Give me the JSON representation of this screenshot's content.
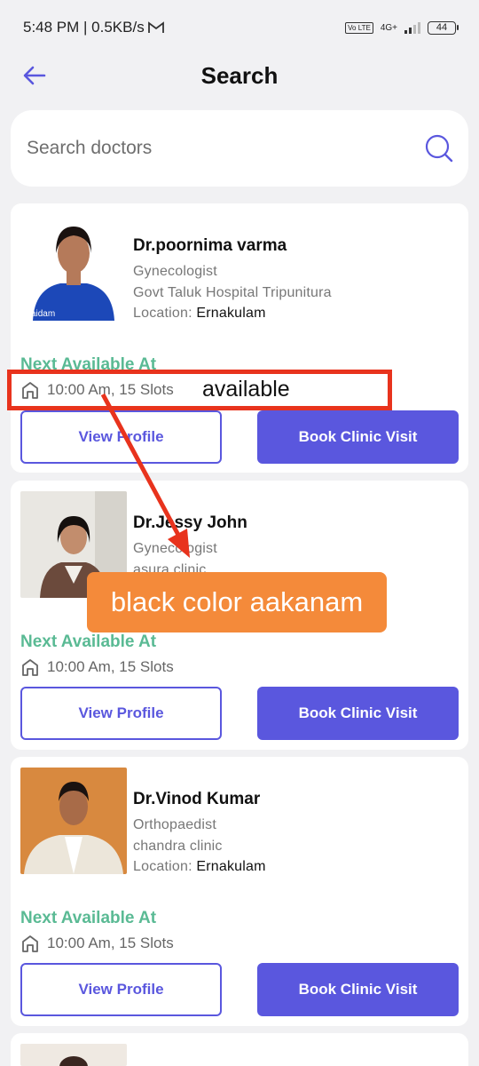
{
  "status_bar": {
    "time_speed": "5:48 PM | 0.5KB/s",
    "mail_icon": "gmail-icon",
    "network": "4G+",
    "volte": "Vo LTE",
    "battery": "44"
  },
  "header": {
    "title": "Search"
  },
  "search": {
    "placeholder": "Search doctors"
  },
  "cards": [
    {
      "name": "Dr.poornima varma",
      "specialty": "Gynecologist",
      "clinic": "Govt Taluk Hospital Tripunitura",
      "location_label": "Location: ",
      "location_value": "Ernakulam",
      "next_label": "Next Available At",
      "slots": "10:00 Am, 15 Slots",
      "view_label": "View Profile",
      "book_label": "Book Clinic Visit",
      "watermark": "Vaidam"
    },
    {
      "name": "Dr.Jessy John",
      "specialty": "Gynecologist",
      "clinic": "asura clinic",
      "next_label": "Next Available At",
      "slots": "10:00 Am, 15 Slots",
      "view_label": "View Profile",
      "book_label": "Book Clinic Visit"
    },
    {
      "name": "Dr.Vinod Kumar",
      "specialty": "Orthopaedist",
      "clinic": "chandra clinic",
      "location_label": "Location: ",
      "location_value": "Ernakulam",
      "next_label": "Next Available At",
      "slots": "10:00 Am, 15 Slots",
      "view_label": "View Profile",
      "book_label": "Book Clinic Visit"
    }
  ],
  "annotations": {
    "box_text": "available",
    "label_text": "black color aakanam"
  },
  "colors": {
    "accent": "#5a57de",
    "green": "#5aba94",
    "annotation_red": "#e8331d",
    "annotation_orange": "#f48a3a"
  }
}
